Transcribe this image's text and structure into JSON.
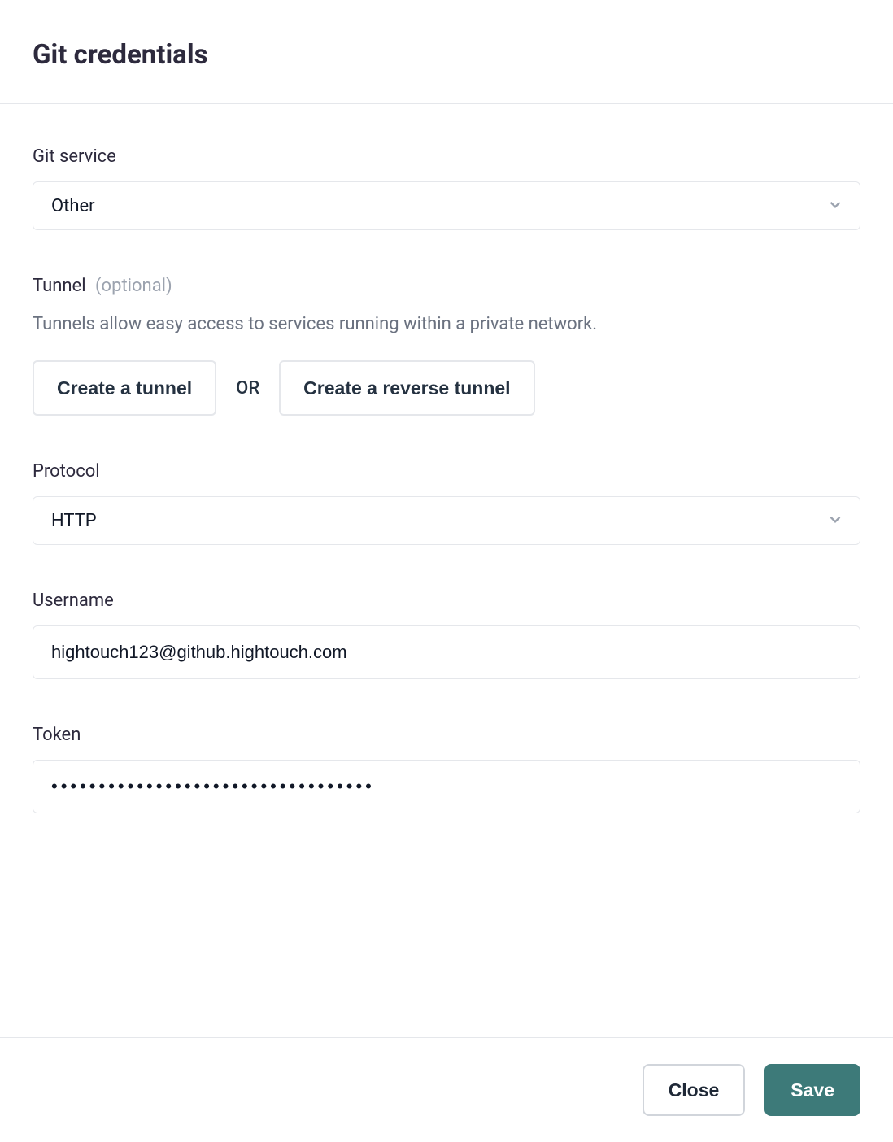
{
  "header": {
    "title": "Git credentials"
  },
  "fields": {
    "gitService": {
      "label": "Git service",
      "value": "Other"
    },
    "tunnel": {
      "label": "Tunnel",
      "optional": "(optional)",
      "helper": "Tunnels allow easy access to services running within a private network.",
      "create_tunnel": "Create a tunnel",
      "or": "OR",
      "create_reverse_tunnel": "Create a reverse tunnel"
    },
    "protocol": {
      "label": "Protocol",
      "value": "HTTP"
    },
    "username": {
      "label": "Username",
      "value": "hightouch123@github.hightouch.com"
    },
    "token": {
      "label": "Token",
      "value": "••••••••••••••••••••••••••••••••••"
    }
  },
  "footer": {
    "close": "Close",
    "save": "Save"
  }
}
